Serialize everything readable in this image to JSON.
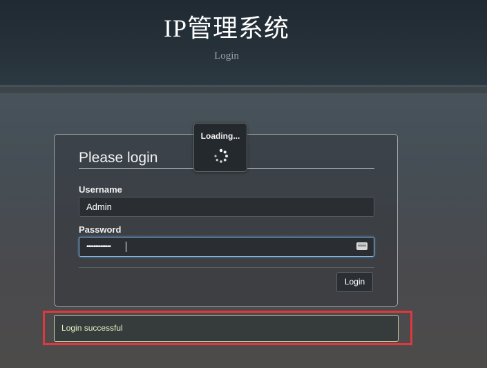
{
  "header": {
    "title": "IP管理系统",
    "subtitle": "Login"
  },
  "login_form": {
    "title": "Please login",
    "username_label": "Username",
    "username_value": "Admin",
    "password_label": "Password",
    "password_value": "••••••••••••••",
    "submit_label": "Login"
  },
  "loading": {
    "text": "Loading..."
  },
  "alert": {
    "message": "Login successful"
  },
  "colors": {
    "highlight": "#e0383d",
    "focus": "#7fb3de",
    "success_text": "#e2edc4"
  },
  "icons": {
    "password_field_icon": "keyboard-icon",
    "loading_indicator": "spinner-icon"
  }
}
